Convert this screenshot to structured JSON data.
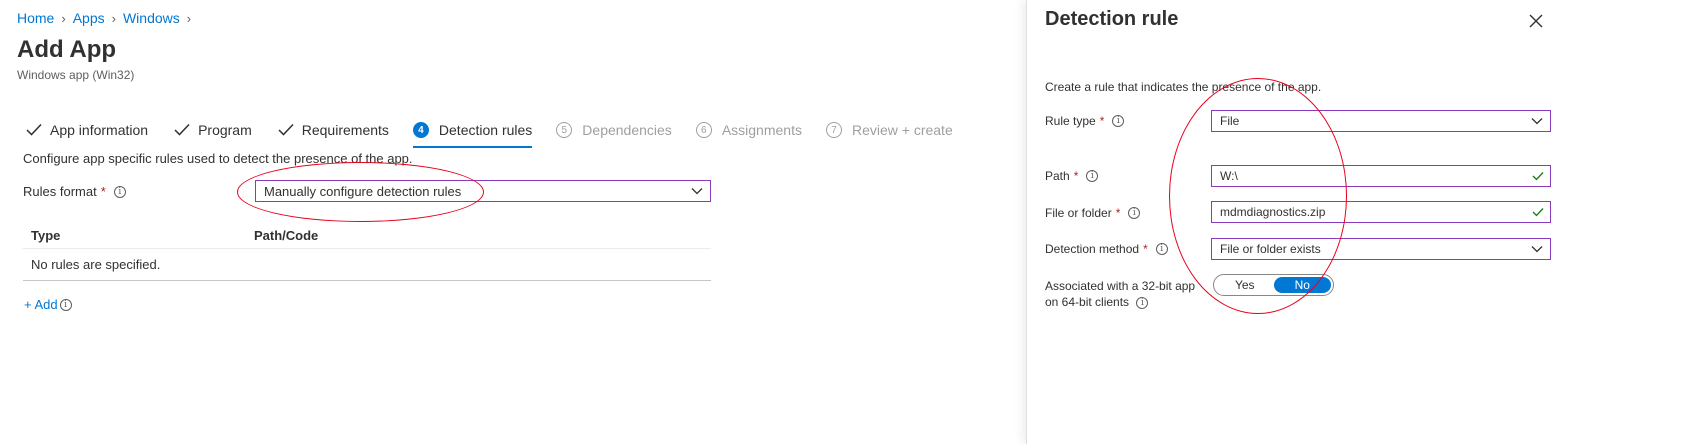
{
  "breadcrumb": {
    "home": "Home",
    "apps": "Apps",
    "windows": "Windows"
  },
  "page": {
    "title": "Add App",
    "subtitle": "Windows app (Win32)"
  },
  "tabs": [
    {
      "label": "App information",
      "state": "done"
    },
    {
      "label": "Program",
      "state": "done"
    },
    {
      "label": "Requirements",
      "state": "done"
    },
    {
      "num": "4",
      "label": "Detection rules",
      "state": "active"
    },
    {
      "num": "5",
      "label": "Dependencies",
      "state": "future"
    },
    {
      "num": "6",
      "label": "Assignments",
      "state": "future"
    },
    {
      "num": "7",
      "label": "Review + create",
      "state": "future"
    }
  ],
  "main": {
    "intro": "Configure app specific rules used to detect the presence of the app.",
    "rules_format_label": "Rules format",
    "rules_format_value": "Manually configure detection rules",
    "table": {
      "col_type": "Type",
      "col_path": "Path/Code",
      "empty": "No rules are specified."
    },
    "add_label": "+ Add"
  },
  "panel": {
    "title": "Detection rule",
    "description": "Create a rule that indicates the presence of the app.",
    "rule_type_label": "Rule type",
    "rule_type_value": "File",
    "path_label": "Path",
    "path_value": "W:\\",
    "file_label": "File or folder",
    "file_value": "mdmdiagnostics.zip",
    "method_label": "Detection method",
    "method_value": "File or folder exists",
    "assoc_label_line1": "Associated with a 32-bit app",
    "assoc_label_line2": "on 64-bit clients",
    "toggle_yes": "Yes",
    "toggle_no": "No",
    "toggle_selected": "No"
  },
  "colors": {
    "accent": "#0078d4",
    "required": "#a4262c",
    "annotation": "#e8001c",
    "valid": "#107c10",
    "field_border": "#8a3bbd"
  },
  "required_marker": "*",
  "info_glyph": "i"
}
